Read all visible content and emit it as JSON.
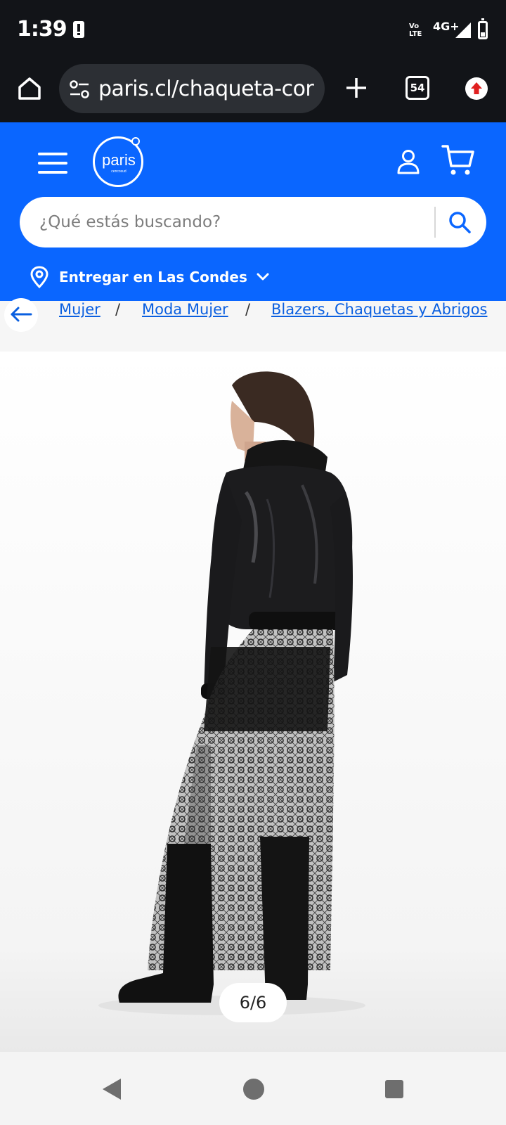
{
  "status": {
    "time": "1:39",
    "volte": "Vo LTE",
    "network": "4G+"
  },
  "browser": {
    "url": "paris.cl/chaqueta-cor",
    "tab_count": "54"
  },
  "header": {
    "logo_text": "paris",
    "logo_sub": "cencosud",
    "search_placeholder": "¿Qué estás buscando?",
    "delivery_label": "Entregar en Las Condes"
  },
  "breadcrumbs": [
    "Mujer",
    "Moda Mujer",
    "Blazers, Chaquetas y Abrigos"
  ],
  "gallery": {
    "counter": "6/6"
  },
  "colors": {
    "brand": "#0a66ff",
    "link": "#0a5fe0",
    "status_bg": "#121418"
  },
  "icons": [
    "home-icon",
    "tune-icon",
    "plus-icon",
    "tabs-icon",
    "update-icon",
    "menu-icon",
    "user-icon",
    "cart-icon",
    "search-icon",
    "location-pin-icon",
    "chevron-down-icon",
    "back-arrow-icon"
  ]
}
